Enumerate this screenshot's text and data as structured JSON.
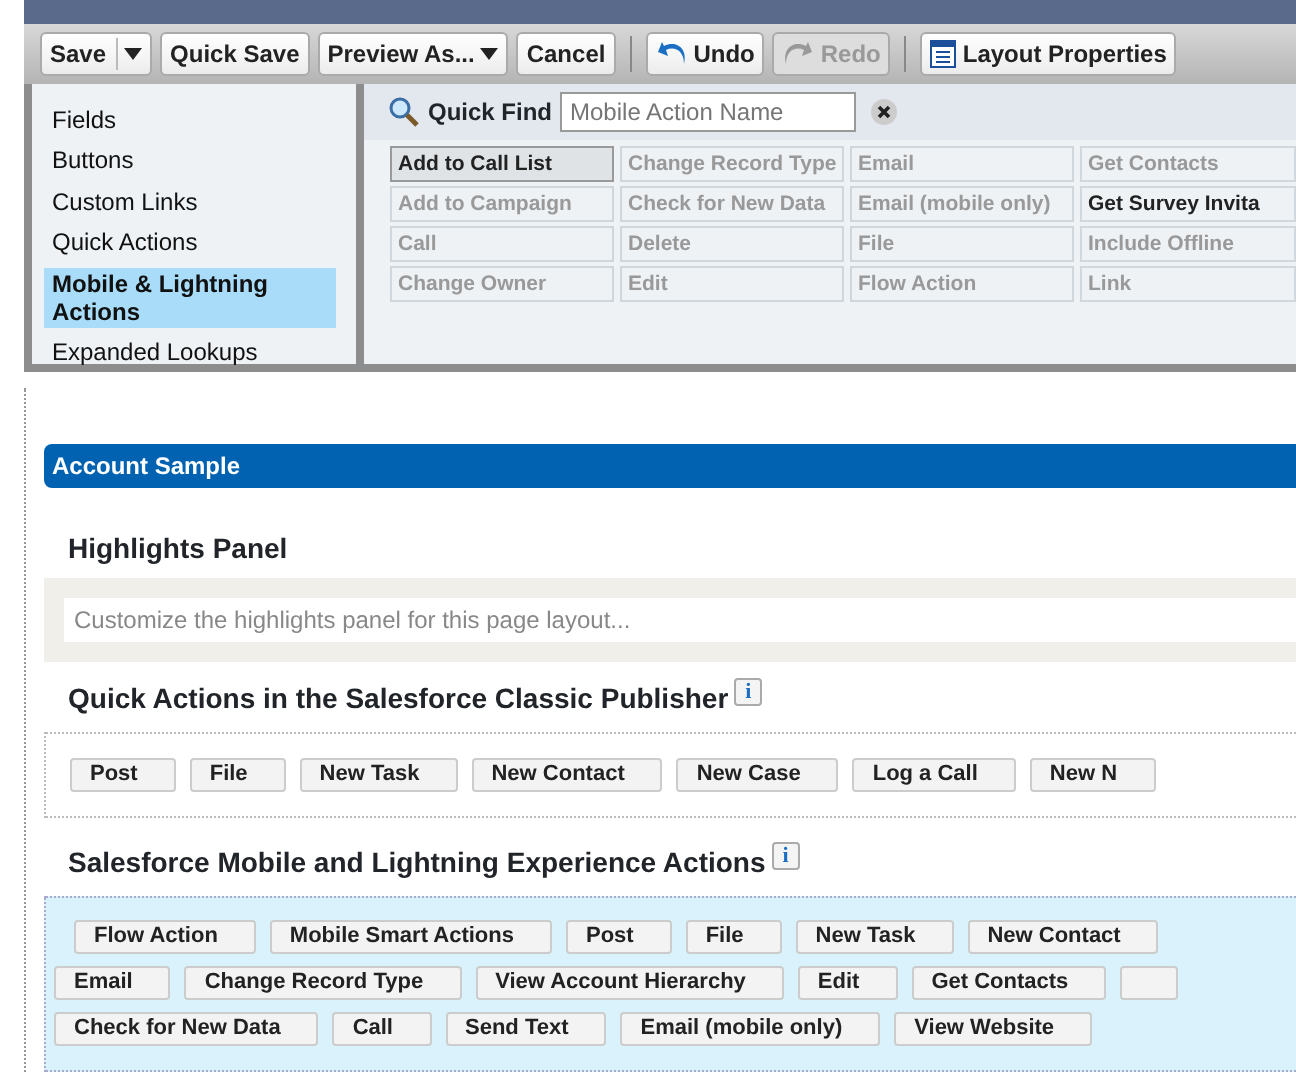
{
  "toolbar": [
    {
      "label": "Save",
      "kind": "split",
      "disabled": false
    },
    {
      "label": "Quick Save",
      "kind": "plain",
      "disabled": false
    },
    {
      "label": "Preview As...",
      "kind": "dropdown",
      "disabled": false
    },
    {
      "label": "Cancel",
      "kind": "plain",
      "disabled": false
    },
    {
      "kind": "separator"
    },
    {
      "label": "Undo",
      "kind": "undo",
      "disabled": false
    },
    {
      "label": "Redo",
      "kind": "redo",
      "disabled": true
    },
    {
      "kind": "separator"
    },
    {
      "label": "Layout Properties",
      "kind": "properties",
      "disabled": false
    }
  ],
  "sidebar": {
    "items": [
      {
        "label": "Fields",
        "selected": false
      },
      {
        "label": "Buttons",
        "selected": false
      },
      {
        "label": "Custom Links",
        "selected": false
      },
      {
        "label": "Quick Actions",
        "selected": false
      },
      {
        "label": "Mobile & Lightning Actions",
        "selected": true
      },
      {
        "label": "Expanded Lookups",
        "selected": false
      }
    ]
  },
  "quick_find": {
    "label": "Quick Find",
    "placeholder": "Mobile Action Name"
  },
  "palette": [
    {
      "label": "Add to Call List",
      "used": false,
      "hovered": true
    },
    {
      "label": "Change Record Type",
      "used": true,
      "hovered": false
    },
    {
      "label": "Email",
      "used": true,
      "hovered": false
    },
    {
      "label": "Get Contacts",
      "used": true,
      "hovered": false
    },
    {
      "label": "Add to Campaign",
      "used": true,
      "hovered": false
    },
    {
      "label": "Check for New Data",
      "used": true,
      "hovered": false
    },
    {
      "label": "Email (mobile only)",
      "used": true,
      "hovered": false
    },
    {
      "label": "Get Survey Invita",
      "used": false,
      "hovered": false
    },
    {
      "label": "Call",
      "used": true,
      "hovered": false
    },
    {
      "label": "Delete",
      "used": true,
      "hovered": false
    },
    {
      "label": "File",
      "used": true,
      "hovered": false
    },
    {
      "label": "Include Offline",
      "used": true,
      "hovered": false
    },
    {
      "label": "Change Owner",
      "used": true,
      "hovered": false
    },
    {
      "label": "Edit",
      "used": true,
      "hovered": false
    },
    {
      "label": "Flow Action",
      "used": true,
      "hovered": false
    },
    {
      "label": "Link",
      "used": true,
      "hovered": false
    }
  ],
  "section": {
    "title": "Account Sample"
  },
  "highlights": {
    "title": "Highlights Panel",
    "placeholder": "Customize the highlights panel for this page layout..."
  },
  "classic_publisher": {
    "title": "Quick Actions in the Salesforce Classic Publisher",
    "info_icon": "i",
    "actions": [
      "Post",
      "File",
      "New Task",
      "New Contact",
      "New Case",
      "Log a Call",
      "New N"
    ]
  },
  "mobile_actions": {
    "title": "Salesforce Mobile and Lightning Experience Actions",
    "info_icon": "i",
    "rows": [
      [
        "Flow Action",
        "Mobile Smart Actions",
        "Post",
        "File",
        "New Task",
        "New Contact"
      ],
      [
        "Email",
        "Change Record Type",
        "View Account Hierarchy",
        "Edit",
        "Get Contacts",
        ""
      ],
      [
        "Check for New Data",
        "Call",
        "Send Text",
        "Email (mobile only)",
        "View Website"
      ]
    ]
  }
}
